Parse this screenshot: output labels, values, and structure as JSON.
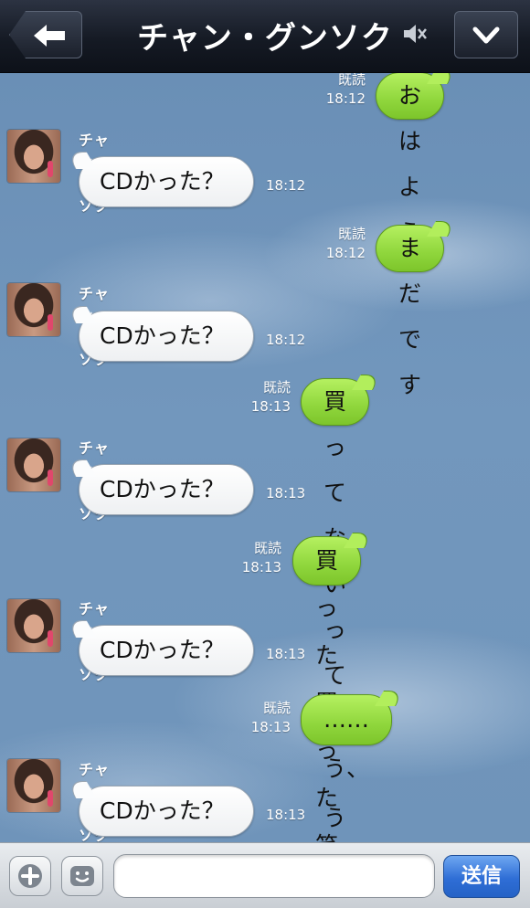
{
  "header": {
    "title": "チャン・グンソク",
    "back_icon": "back-arrow-icon",
    "mute_icon": "speaker-muted-icon",
    "menu_icon": "chevron-down-icon"
  },
  "messages": [
    {
      "type": "out",
      "read": "既読",
      "time": "18:12",
      "text": "おはよう"
    },
    {
      "type": "in",
      "sender": "チャン・グンソク",
      "text": "CDかった？",
      "time": "18:12"
    },
    {
      "type": "out",
      "read": "既読",
      "time": "18:12",
      "text": "まだです"
    },
    {
      "type": "in",
      "sender": "チャン・グンソク",
      "text": "CDかった？",
      "time": "18:12"
    },
    {
      "type": "out",
      "read": "既読",
      "time": "18:13",
      "text": "買ってないって"
    },
    {
      "type": "in",
      "sender": "チャン・グンソク",
      "text": "CDかった？",
      "time": "18:13"
    },
    {
      "type": "out",
      "read": "既読",
      "time": "18:13",
      "text": "買った買った 笑"
    },
    {
      "type": "in",
      "sender": "チャン・グンソク",
      "text": "CDかった？",
      "time": "18:13"
    },
    {
      "type": "out",
      "read": "既読",
      "time": "18:13",
      "text": "……う、うん。"
    },
    {
      "type": "in",
      "sender": "チャン・グンソク",
      "text": "CDかった？",
      "time": "18:13"
    }
  ],
  "input_bar": {
    "message_value": "",
    "send_label": "送信",
    "plus_icon": "plus-icon",
    "sticker_icon": "smiley-icon"
  },
  "colors": {
    "outgoing_bubble": "#9ade48",
    "incoming_bubble": "#ffffff",
    "send_button": "#2f6ed6",
    "header": "#151a24"
  }
}
